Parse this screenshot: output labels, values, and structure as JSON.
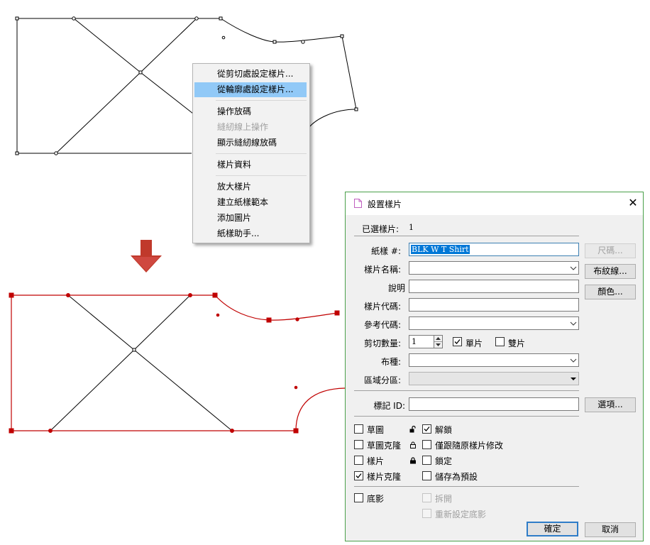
{
  "context_menu": {
    "items": [
      {
        "label": "從剪切處設定樣片...",
        "state": "normal"
      },
      {
        "label": "從輪廓處設定樣片...",
        "state": "highlighted"
      },
      {
        "label": "操作放碼",
        "state": "normal"
      },
      {
        "label": "縫紉線上操作",
        "state": "disabled"
      },
      {
        "label": "顯示縫紉線放碼",
        "state": "normal"
      },
      {
        "label": "樣片資料",
        "state": "normal"
      },
      {
        "label": "放大樣片",
        "state": "normal"
      },
      {
        "label": "建立紙樣範本",
        "state": "normal"
      },
      {
        "label": "添加圖片",
        "state": "normal"
      },
      {
        "label": "紙樣助手...",
        "state": "normal"
      }
    ]
  },
  "dialog": {
    "title": "設置樣片",
    "selected_label": "已選樣片:",
    "selected_count": "1",
    "pattern_label": "紙樣 #:",
    "pattern_value": "BLK W T Shirt",
    "size_button": "尺碼...",
    "piece_name_label": "樣片名稱:",
    "grain_button": "布紋線...",
    "description_label": "說明",
    "color_button": "顏色...",
    "piece_code_label": "樣片代碼:",
    "reference_code_label": "參考代碼:",
    "cut_quantity_label": "剪切數量:",
    "cut_quantity_value": "1",
    "single_label": "單片",
    "pair_label": "雙片",
    "fabric_label": "布種:",
    "zone_label": "區域分區:",
    "marker_id_label": "標記 ID:",
    "options_button": "選項...",
    "sketch_label": "草圖",
    "sketch_clone_label": "草圖克隆",
    "piece_label": "樣片",
    "piece_clone_label": "樣片克隆",
    "unlock_label": "解鎖",
    "follow_original_label": "僅跟隨原樣片修改",
    "lock_label": "鎖定",
    "save_default_label": "儲存為預設",
    "shadow_label": "底影",
    "split_label": "拆開",
    "reset_shadow_label": "重新設定底影",
    "ok_button": "確定",
    "cancel_button": "取消"
  },
  "colors": {
    "accent": "#0078d7",
    "menu_highlight": "#91c9f7",
    "piece_selected": "#c00000",
    "dialog_border": "#4aa04a",
    "arrow": "#c0392b"
  }
}
